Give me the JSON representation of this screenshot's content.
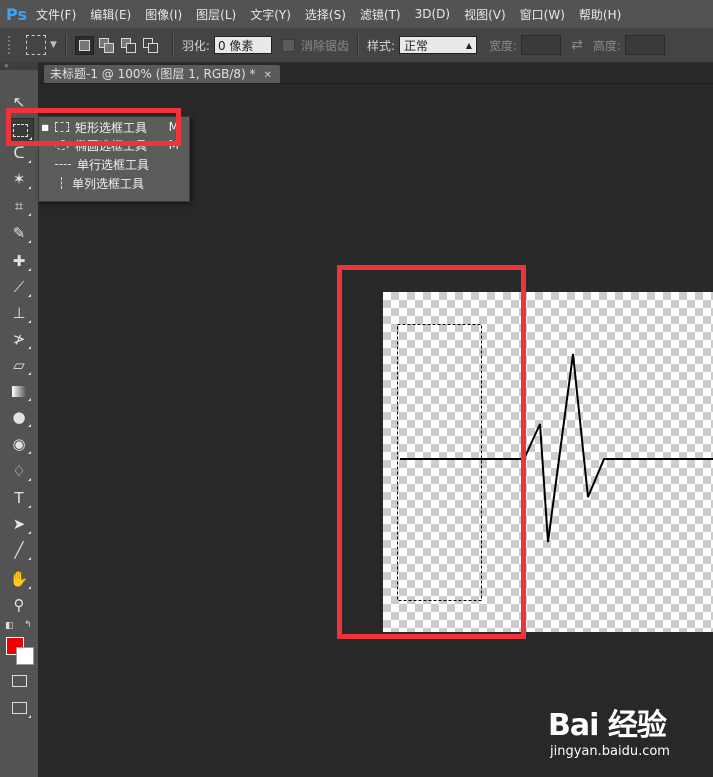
{
  "app": {
    "logo": "Ps"
  },
  "menu": [
    "文件(F)",
    "编辑(E)",
    "图像(I)",
    "图层(L)",
    "文字(Y)",
    "选择(S)",
    "滤镜(T)",
    "3D(D)",
    "视图(V)",
    "窗口(W)",
    "帮助(H)"
  ],
  "options": {
    "feather_label": "羽化:",
    "feather_value": "0 像素",
    "antialias_label": "消除锯齿",
    "style_label": "样式:",
    "style_value": "正常",
    "width_label": "宽度:",
    "height_label": "高度:"
  },
  "document": {
    "tab_title": "未标题-1 @ 100% (图层 1, RGB/8) *"
  },
  "flyout": {
    "items": [
      {
        "label": "矩形选框工具",
        "shortcut": "M",
        "selected": true,
        "icon": "rect-marquee-icon"
      },
      {
        "label": "椭圆选框工具",
        "shortcut": "M",
        "selected": false,
        "icon": "ellipse-marquee-icon"
      },
      {
        "label": "单行选框工具",
        "shortcut": "",
        "selected": false,
        "icon": "single-row-marquee-icon"
      },
      {
        "label": "单列选框工具",
        "shortcut": "",
        "selected": false,
        "icon": "single-column-marquee-icon"
      }
    ]
  },
  "colors": {
    "foreground": "#ee0000",
    "background": "#ffffff",
    "highlight": "#ee343a"
  },
  "watermark": {
    "brand": "Bai 经验",
    "url": "jingyan.baidu.com"
  }
}
